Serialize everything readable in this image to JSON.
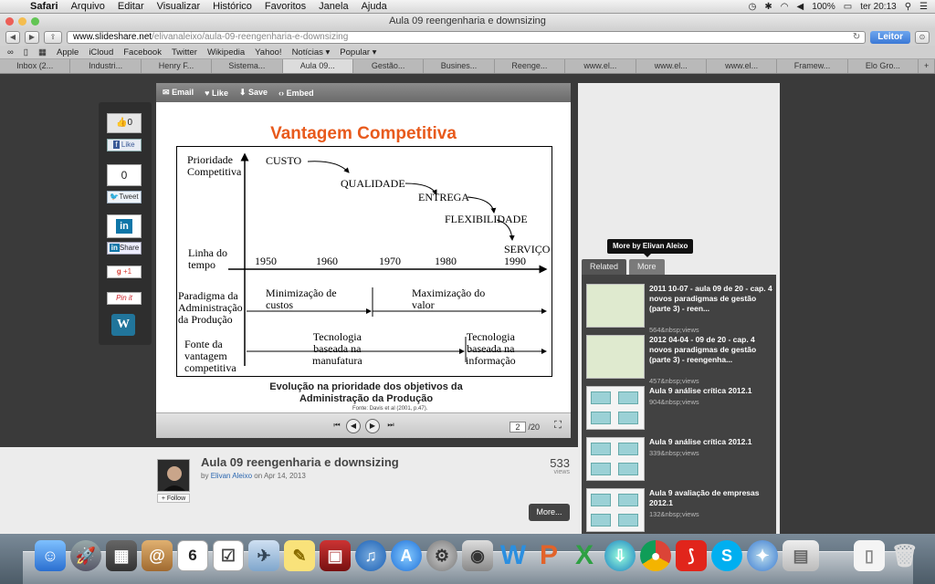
{
  "menubar": {
    "items": [
      "Safari",
      "Arquivo",
      "Editar",
      "Visualizar",
      "Histórico",
      "Favoritos",
      "Janela",
      "Ajuda"
    ],
    "battery": "100%",
    "clock": "ter 20:13"
  },
  "window": {
    "title": "Aula 09 reengenharia e downsizing"
  },
  "toolbar": {
    "url_host": "www.slideshare.net",
    "url_path": "/elivanaleixo/aula-09-reengenharia-e-downsizing",
    "reader": "Leitor"
  },
  "bookmarks": [
    "Apple",
    "iCloud",
    "Facebook",
    "Twitter",
    "Wikipedia",
    "Yahoo!",
    "Notícias ▾",
    "Popular ▾"
  ],
  "tabs": [
    "Inbox (2...",
    "Industri...",
    "Henry F...",
    "Sistema...",
    "Aula 09...",
    "Gestão...",
    "Busines...",
    "Reenge...",
    "www.el...",
    "www.el...",
    "www.el...",
    "Framew...",
    "Elo Gro..."
  ],
  "share": {
    "like_count": "0",
    "like": "Like",
    "tweet_count": "0",
    "tweet": "Tweet",
    "share": "Share",
    "gplus": "+1",
    "pinit": "Pin it"
  },
  "player": {
    "email": "Email",
    "like": "Like",
    "save": "Save",
    "embed": "Embed",
    "page": "2",
    "total": "/20"
  },
  "slide": {
    "title": "Vantagem Competitiva",
    "prioridade": "Prioridade\nCompetitiva",
    "custo": "CUSTO",
    "qualidade": "QUALIDADE",
    "entrega": "ENTREGA",
    "flex": "FLEXIBILIDADE",
    "servico": "SERVIÇO",
    "linha": "Linha do\ntempo",
    "years": [
      "1950",
      "1960",
      "1970",
      "1980",
      "1990"
    ],
    "paradigma": "Paradigma da\nAdministração\nda Produção",
    "minimizacao": "Minimização de\ncustos",
    "maximizacao": "Maximização do\nvalor",
    "fonte_vant": "Fonte da\nvantagem\ncompetitiva",
    "tec_manuf": "Tecnologia\nbaseada na\nmanufatura",
    "tec_info": "Tecnologia\nbaseada na\ninformação",
    "caption": "Evolução na prioridade dos objetivos da Administração da Produção",
    "source": "Fonte: Davis et al (2001, p.47)."
  },
  "sidebar": {
    "tooltip": "More by Elivan Aleixo",
    "tab_related": "Related",
    "tab_more": "More",
    "items": [
      {
        "title": "2011 10-07 - aula 09 de 20 - cap. 4 novos paradigmas de gestão (parte 3) - reen...",
        "views": "564&nbsp;views"
      },
      {
        "title": "2012 04-04 - 09 de 20 - cap. 4 novos paradigmas de gestão (parte 3) - reengenha...",
        "views": "457&nbsp;views"
      },
      {
        "title": "Aula 9 análise crítica 2012.1",
        "views": "904&nbsp;views"
      },
      {
        "title": "Aula 9 análise crítica 2012.1",
        "views": "339&nbsp;views"
      },
      {
        "title": "Aula 9 avaliação de empresas 2012.1",
        "views": "132&nbsp;views"
      }
    ]
  },
  "doc": {
    "title": "Aula 09 reengenharia e downsizing",
    "by": "by",
    "author": "Elivan Aleixo",
    "on": "on Apr 14, 2013",
    "views": "533",
    "views_label": "views",
    "follow": "+ Follow",
    "more": "More..."
  },
  "dock": {
    "calendar_day": "6"
  }
}
